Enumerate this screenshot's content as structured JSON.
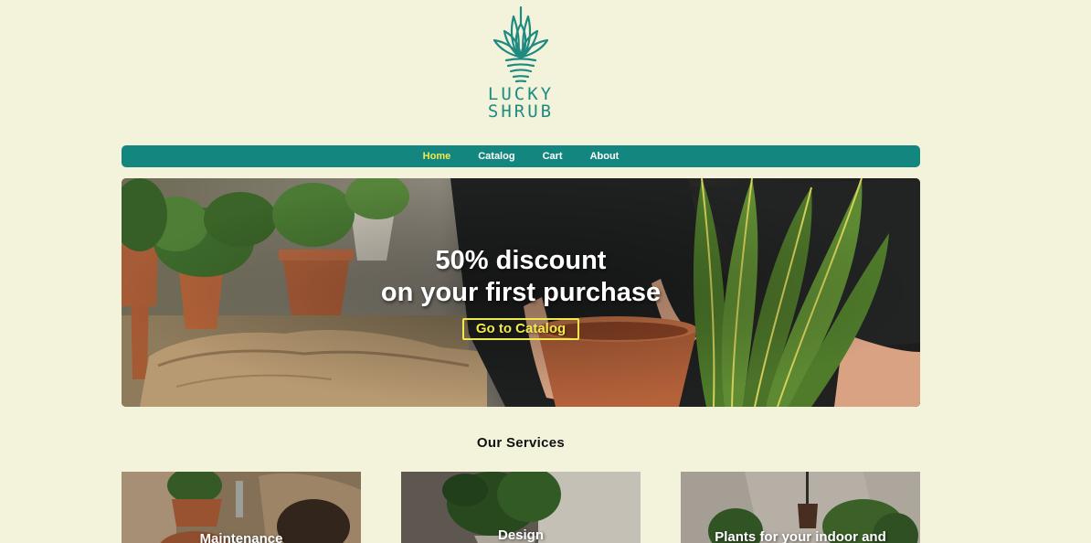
{
  "brand": {
    "name_line1": "LUCKY",
    "name_line2": "SHRUB",
    "color": "#1f8a80"
  },
  "nav": {
    "items": [
      {
        "label": "Home",
        "active": true
      },
      {
        "label": "Catalog",
        "active": false
      },
      {
        "label": "Cart",
        "active": false
      },
      {
        "label": "About",
        "active": false
      }
    ],
    "background": "#13877f",
    "active_color": "#f2e94e"
  },
  "hero": {
    "headline_line1": "50% discount",
    "headline_line2": "on your first purchase",
    "cta_label": "Go to Catalog",
    "cta_color": "#f2e94e"
  },
  "services": {
    "title": "Our Services",
    "cards": [
      {
        "label": "Maintenance"
      },
      {
        "label": "Design"
      },
      {
        "label": "Plants for your indoor and"
      }
    ]
  },
  "icons": {
    "logo": "plant-pot-logo-icon"
  },
  "page_background": "#f3f3dc"
}
